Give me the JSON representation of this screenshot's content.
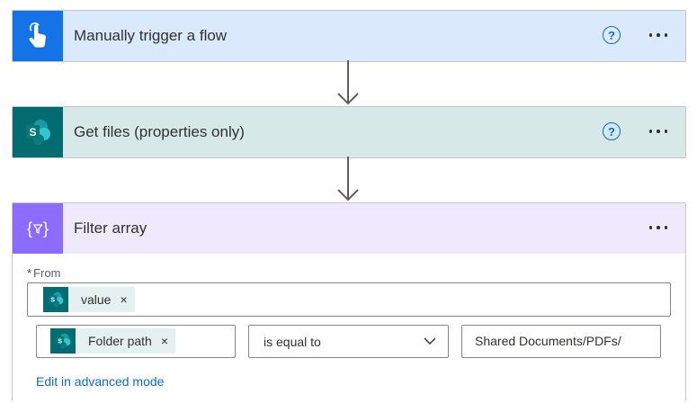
{
  "trigger": {
    "title": "Manually trigger a flow",
    "icon": "touch-hand-icon",
    "header_color": "#dbe9fc",
    "icon_color": "#1473e6"
  },
  "get_files": {
    "title": "Get files (properties only)",
    "icon": "sharepoint-icon",
    "header_color": "#d6e8e8",
    "icon_color": "#036c70"
  },
  "filter": {
    "title": "Filter array",
    "icon": "filter-braces-icon",
    "header_color": "#eee9fc",
    "icon_color": "#8c6cff",
    "from_label": "From",
    "required_marker": "*",
    "from_token": "value",
    "condition_left_token": "Folder path",
    "operator": "is equal to",
    "condition_value": "Shared Documents/PDFs/",
    "advanced_link": "Edit in advanced mode",
    "token_remove": "×"
  },
  "help_glyph": "?"
}
